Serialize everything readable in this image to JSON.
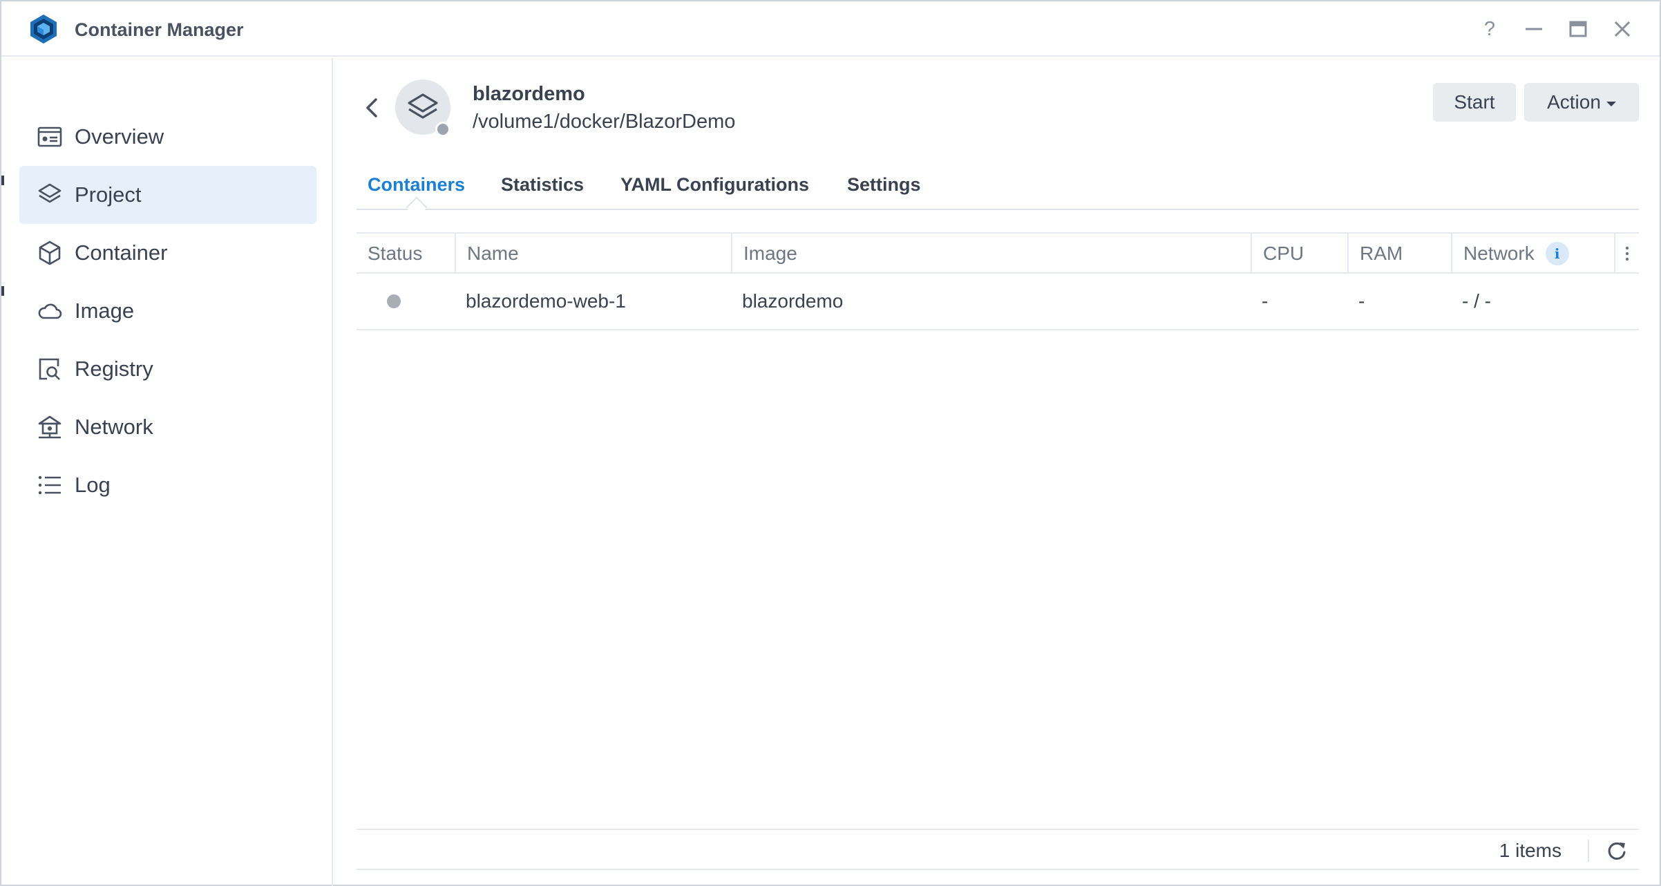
{
  "window": {
    "title": "Container Manager",
    "controls": {
      "help": "?",
      "minimize": "—",
      "maximize": "▭",
      "close": "✕"
    }
  },
  "sidebar": {
    "items": [
      {
        "label": "Overview",
        "icon": "overview-icon",
        "active": false
      },
      {
        "label": "Project",
        "icon": "layers-icon",
        "active": true
      },
      {
        "label": "Container",
        "icon": "cube-icon",
        "active": false
      },
      {
        "label": "Image",
        "icon": "cloud-icon",
        "active": false
      },
      {
        "label": "Registry",
        "icon": "registry-search-icon",
        "active": false
      },
      {
        "label": "Network",
        "icon": "network-icon",
        "active": false
      },
      {
        "label": "Log",
        "icon": "list-icon",
        "active": false
      }
    ]
  },
  "project": {
    "name": "blazordemo",
    "path": "/volume1/docker/BlazorDemo",
    "status": "stopped"
  },
  "toolbar": {
    "start_label": "Start",
    "action_label": "Action"
  },
  "tabs": [
    {
      "label": "Containers",
      "active": true
    },
    {
      "label": "Statistics",
      "active": false
    },
    {
      "label": "YAML Configurations",
      "active": false
    },
    {
      "label": "Settings",
      "active": false
    }
  ],
  "table": {
    "columns": [
      "Status",
      "Name",
      "Image",
      "CPU",
      "RAM",
      "Network"
    ],
    "info_glyph": "i",
    "rows": [
      {
        "status": "stopped",
        "name": "blazordemo-web-1",
        "image": "blazordemo",
        "cpu": "-",
        "ram": "-",
        "network": "- / -"
      }
    ]
  },
  "footer": {
    "count": "1 items"
  },
  "colors": {
    "accent": "#1b7fd6",
    "active_bg": "#e7f0fa",
    "stopped_dot": "#a9aeb6"
  }
}
